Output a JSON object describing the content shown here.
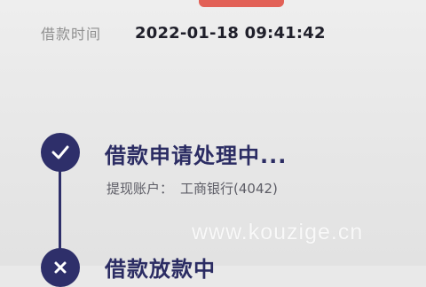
{
  "loan": {
    "time_label": "借款时间",
    "time_value": "2022-01-18 09:41:42"
  },
  "steps": [
    {
      "title": "借款申请处理中...",
      "sub_label": "提现账户：",
      "sub_value": "工商银行(4042)",
      "icon": "check-icon",
      "status": "done"
    },
    {
      "title": "借款放款中",
      "icon": "x-icon",
      "status": "pending"
    }
  ],
  "watermark": "www.kouzige.cn",
  "colors": {
    "accent": "#2e2f6a",
    "top_bar": "#e0584e",
    "text_muted": "#8f8f8f"
  }
}
